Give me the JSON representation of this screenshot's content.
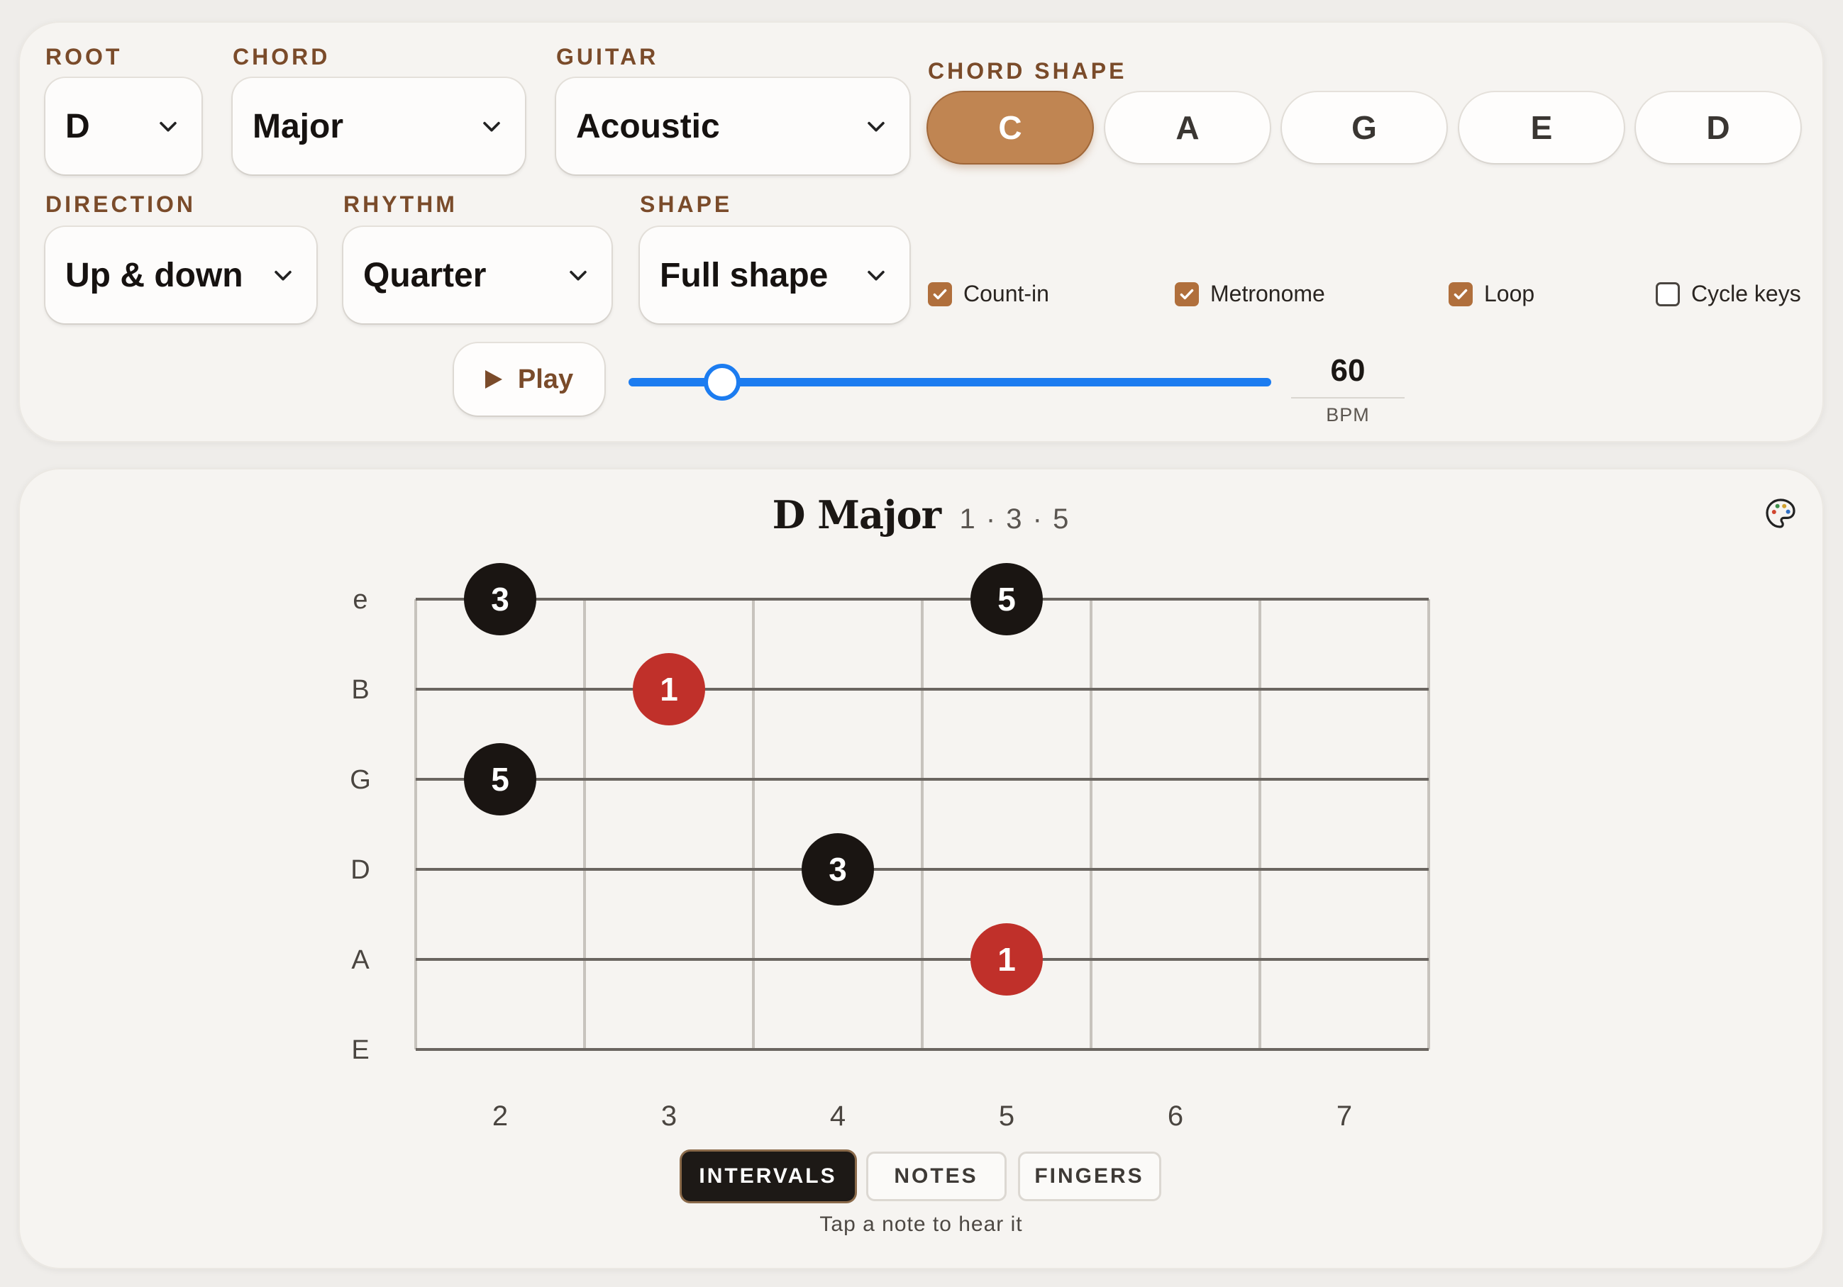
{
  "controls": {
    "root": {
      "label": "ROOT",
      "value": "D"
    },
    "chord": {
      "label": "CHORD",
      "value": "Major"
    },
    "guitar": {
      "label": "GUITAR",
      "value": "Acoustic"
    },
    "chord_shape": {
      "label": "CHORD SHAPE",
      "options": [
        "C",
        "A",
        "G",
        "E",
        "D"
      ],
      "selected": "C"
    },
    "direction": {
      "label": "DIRECTION",
      "value": "Up & down"
    },
    "rhythm": {
      "label": "RHYTHM",
      "value": "Quarter"
    },
    "shape": {
      "label": "SHAPE",
      "value": "Full shape"
    },
    "checkboxes": [
      {
        "label": "Count-in",
        "checked": true
      },
      {
        "label": "Metronome",
        "checked": true
      },
      {
        "label": "Loop",
        "checked": true
      },
      {
        "label": "Cycle keys",
        "checked": false
      }
    ],
    "play_label": "Play",
    "tempo": {
      "value": "60",
      "unit": "BPM",
      "slider_fraction": 0.15
    }
  },
  "fretboard": {
    "chord_name": "D Major",
    "formula": "1 · 3 · 5",
    "strings": [
      "e",
      "B",
      "G",
      "D",
      "A",
      "E"
    ],
    "frets": [
      "2",
      "3",
      "4",
      "5",
      "6",
      "7"
    ],
    "notes": [
      {
        "string": "e",
        "fret": "2",
        "label": "3",
        "root": false
      },
      {
        "string": "e",
        "fret": "5",
        "label": "5",
        "root": false
      },
      {
        "string": "B",
        "fret": "3",
        "label": "1",
        "root": true
      },
      {
        "string": "G",
        "fret": "2",
        "label": "5",
        "root": false
      },
      {
        "string": "D",
        "fret": "4",
        "label": "3",
        "root": false
      },
      {
        "string": "A",
        "fret": "5",
        "label": "1",
        "root": true
      }
    ],
    "colors": {
      "root": "#c0302a",
      "other": "#1a1512"
    },
    "tabs": [
      "INTERVALS",
      "NOTES",
      "FINGERS"
    ],
    "active_tab": "INTERVALS",
    "hint": "Tap a note to hear it"
  }
}
